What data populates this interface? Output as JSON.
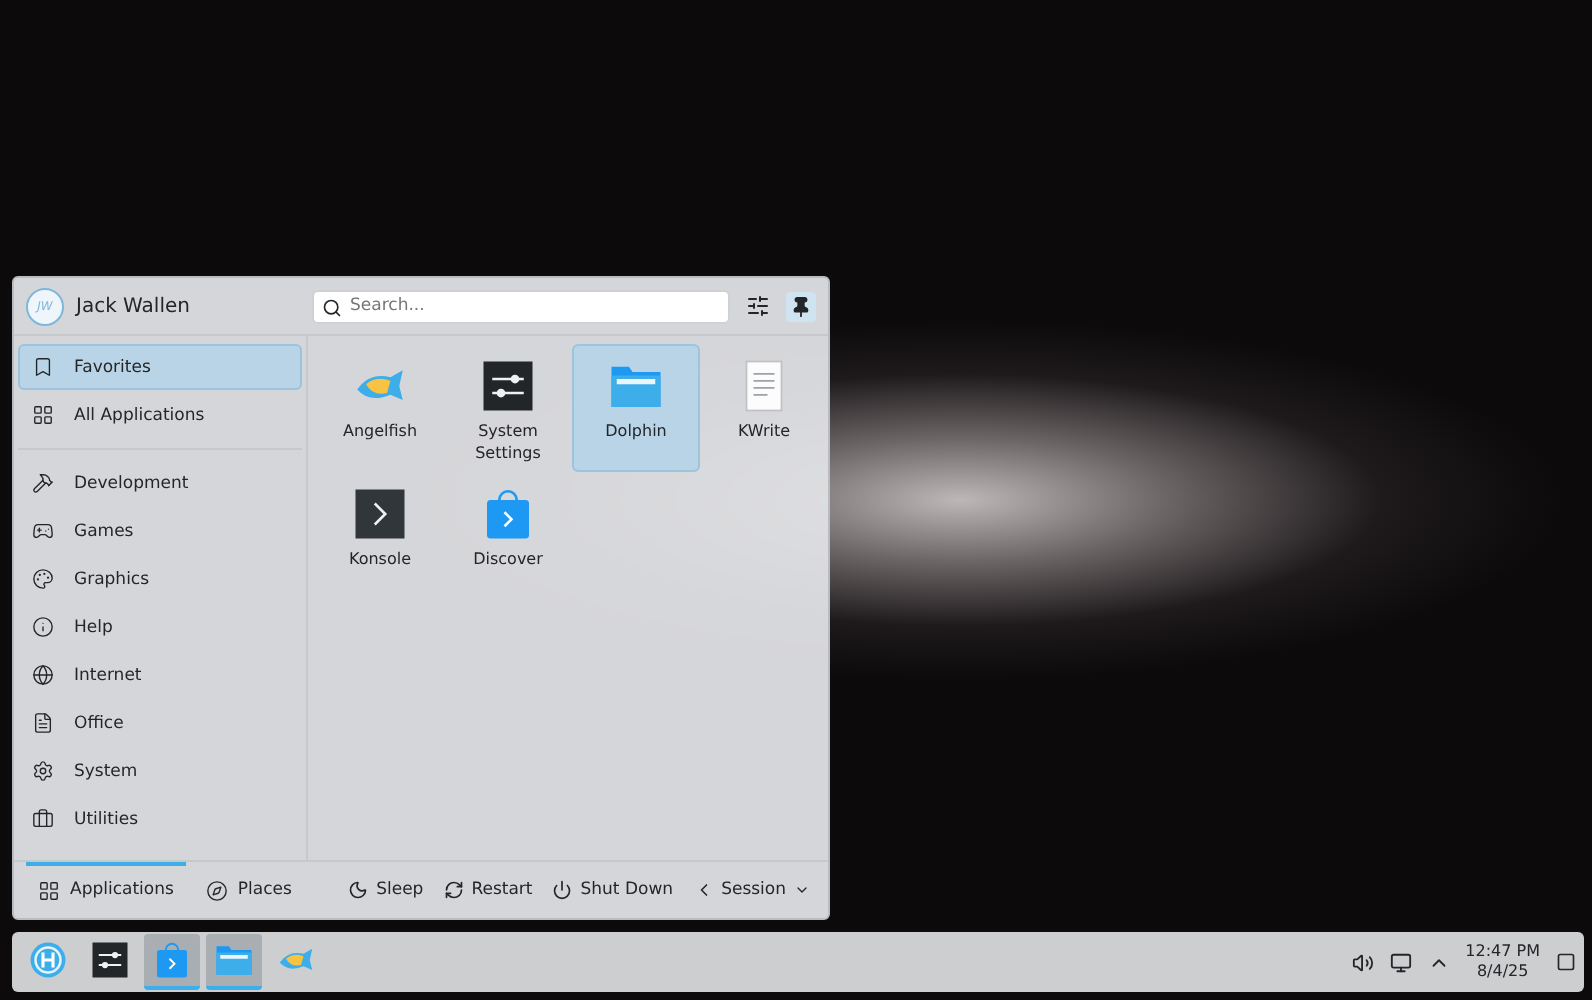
{
  "launcher": {
    "user": {
      "name": "Jack Wallen",
      "initials": "JW"
    },
    "search": {
      "placeholder": "Search..."
    },
    "pinned": true,
    "sidebar": {
      "top": [
        {
          "label": "Favorites",
          "kind": "favorites",
          "selected": true
        },
        {
          "label": "All Applications",
          "kind": "grid",
          "selected": false
        }
      ],
      "categories": [
        {
          "label": "Development",
          "kind": "development",
          "selected": false
        },
        {
          "label": "Games",
          "kind": "games",
          "selected": false
        },
        {
          "label": "Graphics",
          "kind": "graphics",
          "selected": false
        },
        {
          "label": "Help",
          "kind": "help",
          "selected": false
        },
        {
          "label": "Internet",
          "kind": "internet",
          "selected": false
        },
        {
          "label": "Office",
          "kind": "office",
          "selected": false
        },
        {
          "label": "System",
          "kind": "system",
          "selected": false
        },
        {
          "label": "Utilities",
          "kind": "utilities",
          "selected": false
        }
      ]
    },
    "apps": [
      {
        "label": "Angelfish",
        "kind": "fish",
        "selected": false
      },
      {
        "label": "System Settings",
        "kind": "settings",
        "selected": false
      },
      {
        "label": "Dolphin",
        "kind": "folder",
        "selected": true
      },
      {
        "label": "KWrite",
        "kind": "document",
        "selected": false
      },
      {
        "label": "Konsole",
        "kind": "terminal",
        "selected": false
      },
      {
        "label": "Discover",
        "kind": "store",
        "selected": false
      }
    ],
    "footer_tabs": [
      {
        "label": "Applications",
        "kind": "grid",
        "selected": true
      },
      {
        "label": "Places",
        "kind": "compass",
        "selected": false
      }
    ],
    "power": [
      {
        "label": "Sleep",
        "kind": "sleep"
      },
      {
        "label": "Restart",
        "kind": "restart"
      },
      {
        "label": "Shut Down",
        "kind": "shutdown"
      },
      {
        "label": "Session",
        "kind": "session"
      }
    ]
  },
  "taskbar": {
    "tasks": [
      {
        "kind": "launcher",
        "running": false
      },
      {
        "kind": "settings",
        "running": false
      },
      {
        "kind": "store",
        "running": true
      },
      {
        "kind": "folder",
        "running": true
      },
      {
        "kind": "fish",
        "running": false
      }
    ],
    "clock": {
      "time": "12:47 PM",
      "date": "8/4/25"
    }
  }
}
